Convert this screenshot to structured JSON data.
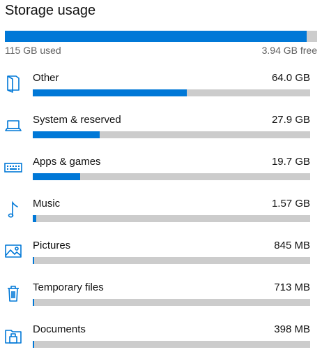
{
  "title": "Storage usage",
  "total": {
    "used_label": "115 GB used",
    "free_label": "3.94 GB free",
    "used_fraction": 0.967
  },
  "accent_color": "#0078d7",
  "track_color": "#cccccc",
  "categories": [
    {
      "name": "Other",
      "size": "64.0 GB",
      "fraction": 0.556,
      "icon": "other-icon"
    },
    {
      "name": "System & reserved",
      "size": "27.9 GB",
      "fraction": 0.242,
      "icon": "laptop-icon"
    },
    {
      "name": "Apps & games",
      "size": "19.7 GB",
      "fraction": 0.171,
      "icon": "keyboard-icon"
    },
    {
      "name": "Music",
      "size": "1.57 GB",
      "fraction": 0.012,
      "icon": "music-note-icon"
    },
    {
      "name": "Pictures",
      "size": "845 MB",
      "fraction": 0.006,
      "icon": "picture-icon"
    },
    {
      "name": "Temporary files",
      "size": "713 MB",
      "fraction": 0.005,
      "icon": "trash-icon"
    },
    {
      "name": "Documents",
      "size": "398 MB",
      "fraction": 0.003,
      "icon": "documents-icon"
    }
  ]
}
